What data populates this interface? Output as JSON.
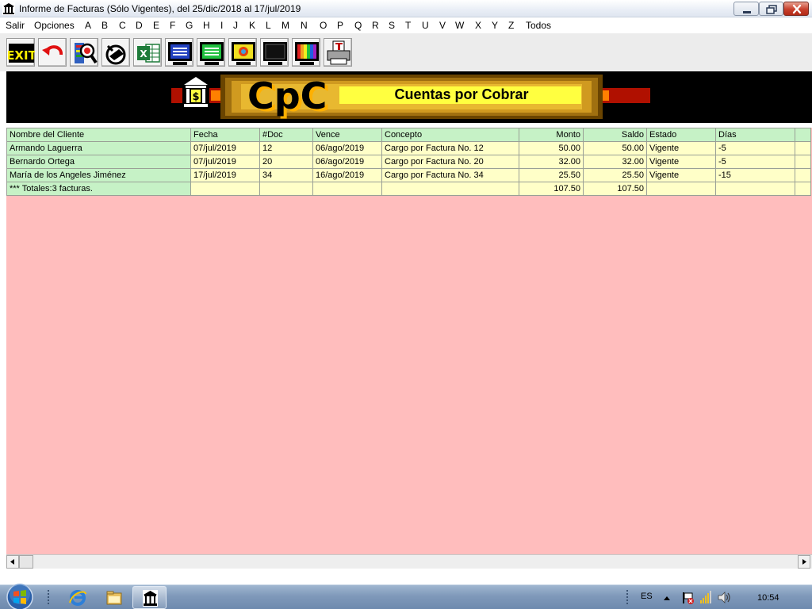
{
  "window": {
    "title": "Informe de Facturas (Sólo Vigentes), del 25/dic/2018 al 17/jul/2019"
  },
  "menu": {
    "items": [
      "Salir",
      "Opciones",
      "A",
      "B",
      "C",
      "D",
      "E",
      "F",
      "G",
      "H",
      "I",
      "J",
      "K",
      "L",
      "M",
      "N",
      "O",
      "P",
      "Q",
      "R",
      "S",
      "T",
      "U",
      "V",
      "W",
      "X",
      "Y",
      "Z",
      "Todos"
    ]
  },
  "toolbar": {
    "exit_label": "EXIT",
    "excel_label": "X",
    "buttons": [
      "exit",
      "undo",
      "search-report",
      "binoculars",
      "excel",
      "screen-blue",
      "screen-green",
      "screen-yellow",
      "screen-black",
      "screen-color",
      "printer"
    ]
  },
  "banner": {
    "logo": "CpC",
    "subtitle": "Cuentas por Cobrar"
  },
  "grid": {
    "columns": [
      "Nombre del Cliente",
      "Fecha",
      "#Doc",
      "Vence",
      "Concepto",
      "Monto",
      "Saldo",
      "Estado",
      "Días"
    ],
    "rows": [
      [
        "Armando Laguerra",
        "07/jul/2019",
        "12",
        "06/ago/2019",
        "Cargo por Factura No. 12",
        "50.00",
        "50.00",
        "Vigente",
        "-5"
      ],
      [
        "Bernardo Ortega",
        "07/jul/2019",
        "20",
        "06/ago/2019",
        "Cargo por Factura No. 20",
        "32.00",
        "32.00",
        "Vigente",
        "-5"
      ],
      [
        "María de los Angeles Jiménez",
        "17/jul/2019",
        "34",
        "16/ago/2019",
        "Cargo por Factura No. 34",
        "25.50",
        "25.50",
        "Vigente",
        "-15"
      ]
    ],
    "totals": {
      "label": "*** Totales:3 facturas.",
      "monto": "107.50",
      "saldo": "107.50"
    }
  },
  "taskbar": {
    "language": "ES",
    "clock": "10:54"
  },
  "colors": {
    "grid_header": "#c6f2c6",
    "grid_cell": "#ffffc8",
    "grid_background": "#ffbdbd",
    "banner_gold": "#f0c000"
  }
}
